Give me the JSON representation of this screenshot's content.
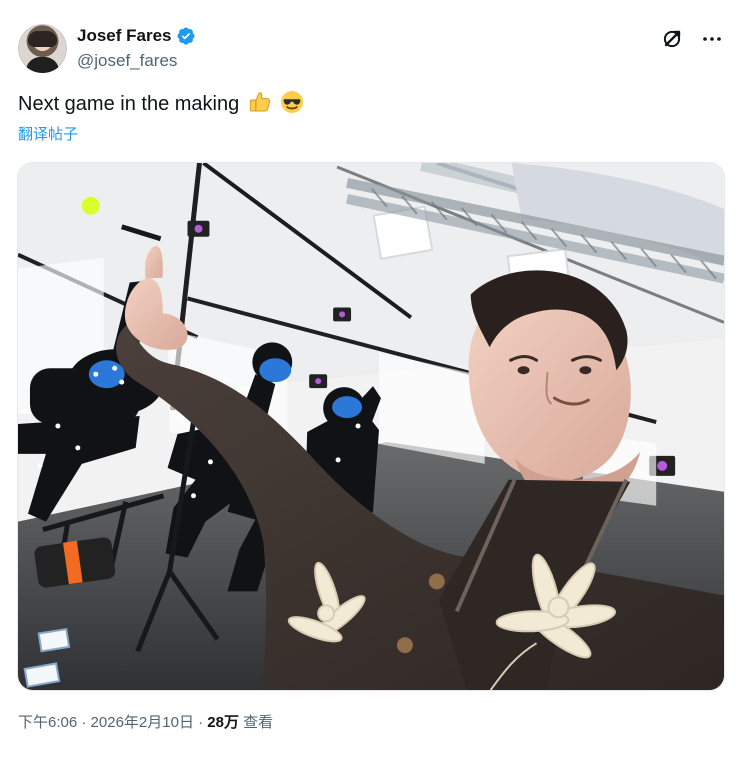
{
  "user": {
    "display_name": "Josef Fares",
    "handle": "@josef_fares",
    "verified": true
  },
  "tweet": {
    "text": "Next game in the making",
    "emoji_icons": [
      "thumbs-up-icon",
      "sunglasses-face-icon"
    ],
    "translate_label": "翻译帖子"
  },
  "footer": {
    "time": "下午6:06",
    "dot1": " · ",
    "date": "2026年2月10日",
    "dot2": " · ",
    "views_count": "28万",
    "views_label": " 查看"
  },
  "colors": {
    "link": "#1d9bf0",
    "secondary_text": "#536471",
    "primary_text": "#0f1419"
  }
}
